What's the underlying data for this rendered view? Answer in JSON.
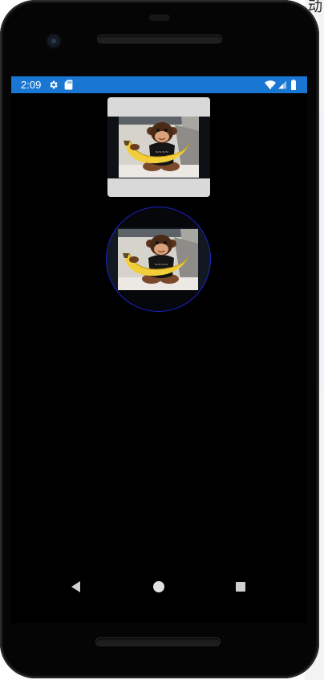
{
  "desktop": {
    "corner_text": "动"
  },
  "status_bar": {
    "time": "2:09",
    "color": "#1976d2",
    "left_icons": [
      "gear-icon",
      "sd-card-icon"
    ],
    "right_icons": [
      "wifi-icon",
      "cell-signal-icon",
      "battery-icon"
    ]
  },
  "screen": {
    "background": "#000000",
    "images": [
      {
        "shape": "rounded-square",
        "subject": "toy monkey holding a banana",
        "frame_color": "#d9d9d9"
      },
      {
        "shape": "circle",
        "subject": "toy monkey holding a banana",
        "ring_color": "#1b22c8"
      }
    ]
  },
  "nav_bar": {
    "buttons": [
      "back-icon",
      "home-icon",
      "recents-icon"
    ]
  }
}
